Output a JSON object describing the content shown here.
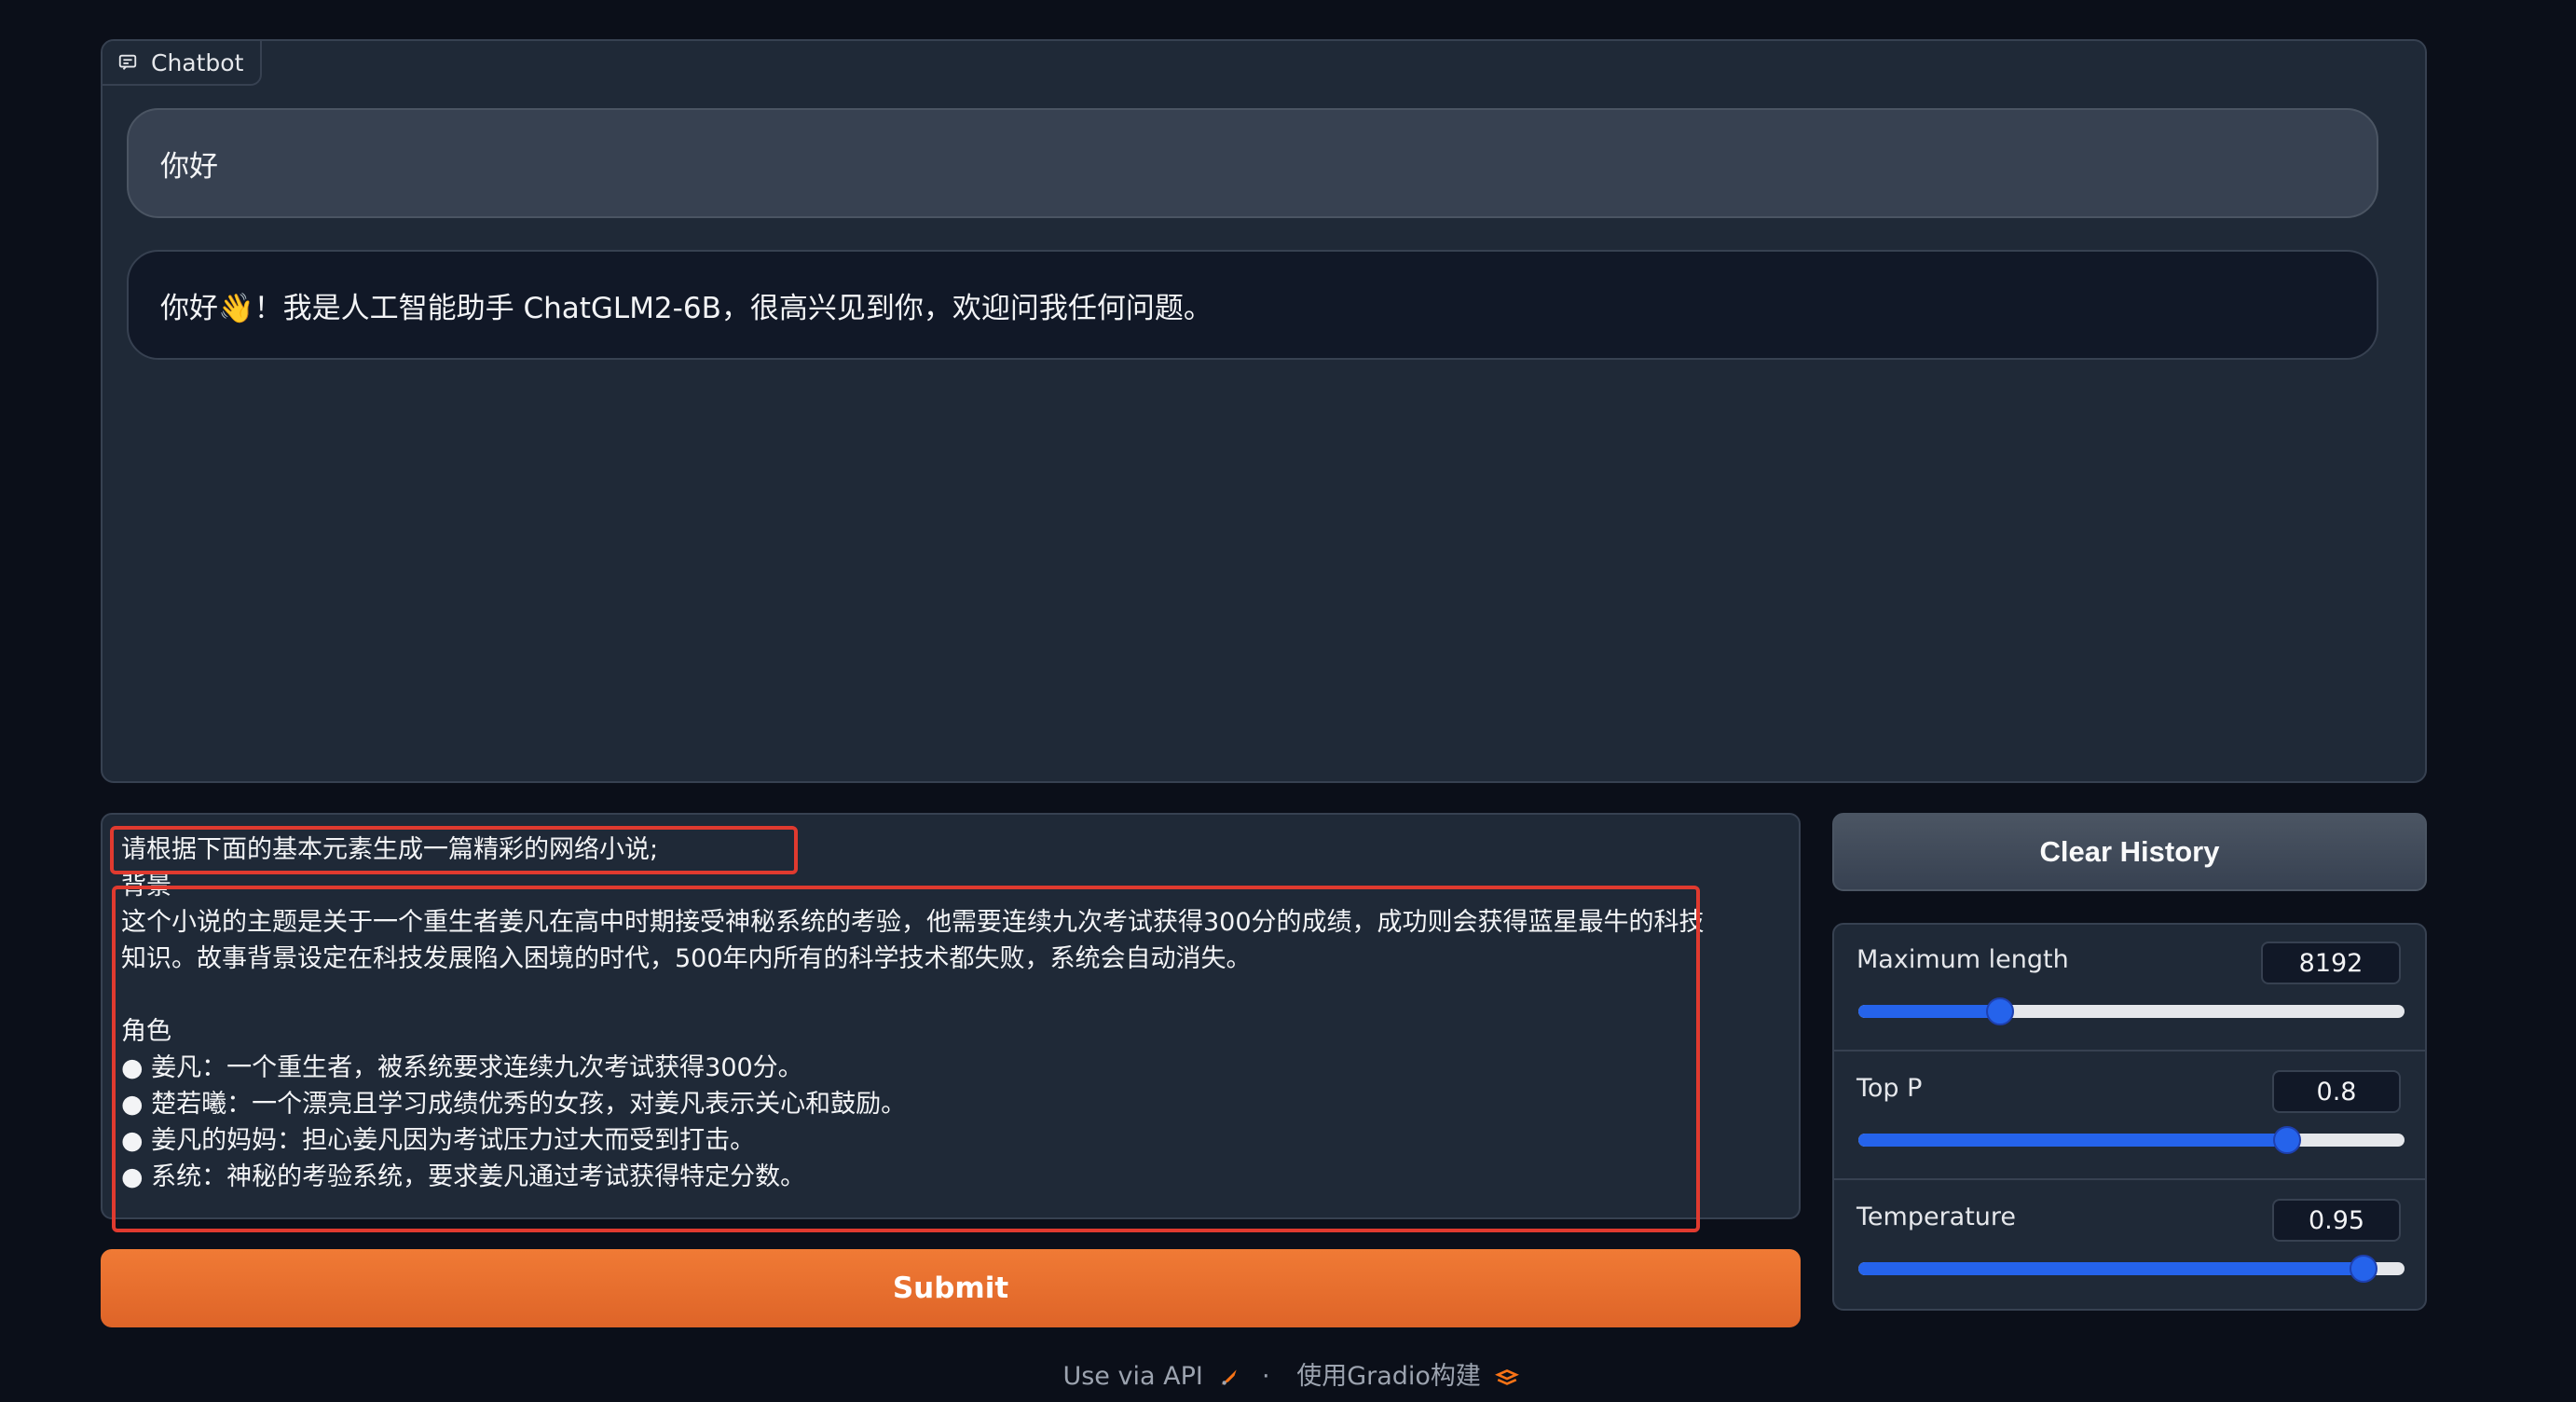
{
  "chatbot": {
    "label": "Chatbot",
    "messages": [
      {
        "role": "user",
        "text": "你好"
      },
      {
        "role": "bot",
        "text": "你好👋！我是人工智能助手 ChatGLM2-6B，很高兴见到你，欢迎问我任何问题。"
      }
    ]
  },
  "input": {
    "lines": [
      "请根据下面的基本元素生成一篇精彩的网络小说;",
      "背景",
      "这个小说的主题是关于一个重生者姜凡在高中时期接受神秘系统的考验，他需要连续九次考试获得300分的成绩，成功则会获得蓝星最牛的科技",
      "知识。故事背景设定在科技发展陷入困境的时代，500年内所有的科学技术都失败，系统会自动消失。",
      "",
      "角色",
      "● 姜凡：一个重生者，被系统要求连续九次考试获得300分。",
      "● 楚若曦：一个漂亮且学习成绩优秀的女孩，对姜凡表示关心和鼓励。",
      "● 姜凡的妈妈：担心姜凡因为考试压力过大而受到打击。",
      "● 系统：神秘的考验系统，要求姜凡通过考试获得特定分数。"
    ]
  },
  "buttons": {
    "submit": "Submit",
    "clear_history": "Clear History"
  },
  "sliders": [
    {
      "label": "Maximum length",
      "value": "8192",
      "fraction": 0.26
    },
    {
      "label": "Top P",
      "value": "0.8",
      "fraction": 0.785
    },
    {
      "label": "Temperature",
      "value": "0.95",
      "fraction": 0.925
    }
  ],
  "footer": {
    "api": "Use via API",
    "separator": "·",
    "built_with": "使用Gradio构建"
  },
  "colors": {
    "accent": "#2563eb",
    "submit": "#e8702e",
    "highlight": "#e03a2f"
  }
}
